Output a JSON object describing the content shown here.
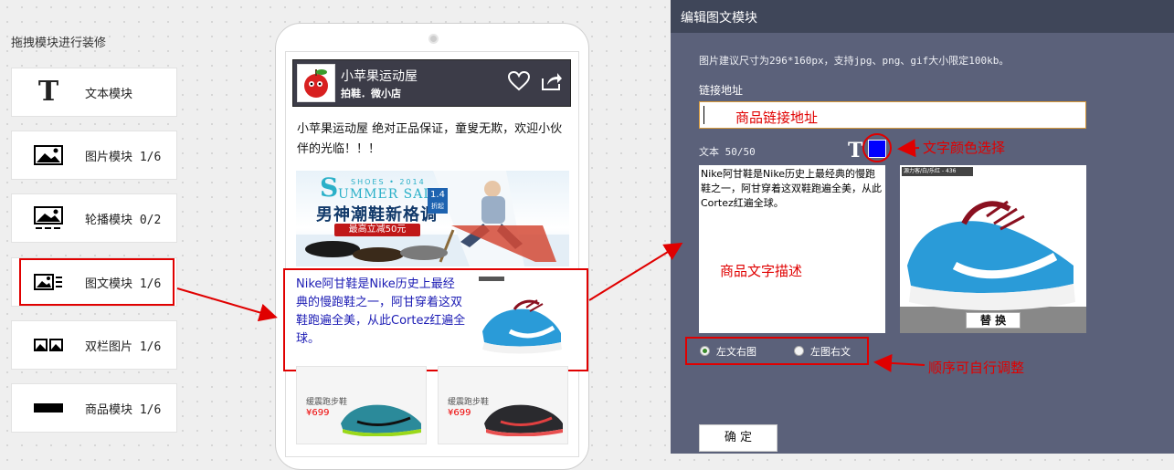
{
  "left_panel": {
    "title": "拖拽模块进行装修",
    "modules": [
      {
        "label": "文本模块",
        "count": "",
        "icon": "text-t-icon"
      },
      {
        "label": "图片模块",
        "count": "1/6",
        "icon": "image-icon"
      },
      {
        "label": "轮播模块",
        "count": "0/2",
        "icon": "carousel-icon"
      },
      {
        "label": "图文模块",
        "count": "1/6",
        "icon": "image-text-icon"
      },
      {
        "label": "双栏图片",
        "count": "1/6",
        "icon": "double-image-icon"
      },
      {
        "label": "商品模块",
        "count": "1/6",
        "icon": "product-bar-icon"
      }
    ]
  },
  "phone": {
    "shop_name": "小苹果运动屋",
    "shop_sub": "拍鞋．微小店",
    "welcome": "小苹果运动屋 绝对正品保证，童叟无欺，欢迎小伙伴的光临！！！",
    "banner": {
      "summer": "UMMER SALE",
      "summer_year": "SHOES • 2014",
      "headline": "男神潮鞋新格调",
      "promo": "最高立减50元",
      "discount": "1.4",
      "discount_unit": "折起"
    },
    "imgtext": "Nike阿甘鞋是Nike历史上最经典的慢跑鞋之一，阿甘穿着这双鞋跑遍全美，从此Cortez红遍全球。",
    "products": [
      {
        "title": "缓震跑步鞋",
        "price": "¥699"
      },
      {
        "title": "缓震跑步鞋",
        "price": "¥699"
      }
    ]
  },
  "editor": {
    "title": "编辑图文模块",
    "hint": "图片建议尺寸为296*160px，支持jpg、png、gif大小限定100kb。",
    "link_label": "链接地址",
    "link_placeholder_note": "商品链接地址",
    "text_label": "文本 50/50",
    "text_color": "#0000ff",
    "text_content": "Nike阿甘鞋是Nike历史上最经典的慢跑鞋之一，阿甘穿着这双鞋跑遍全美，从此Cortez红遍全球。",
    "text_desc_note": "商品文字描述",
    "preview_tag": "源力客/白/乐红 - 436",
    "replace_label": "替 换",
    "order_options": [
      "左文右图",
      "左图右文"
    ],
    "order_selected": "左文右图",
    "confirm_label": "确 定"
  },
  "annotations": {
    "color_select": "文字颜色选择",
    "order_adjust": "顺序可自行调整"
  }
}
